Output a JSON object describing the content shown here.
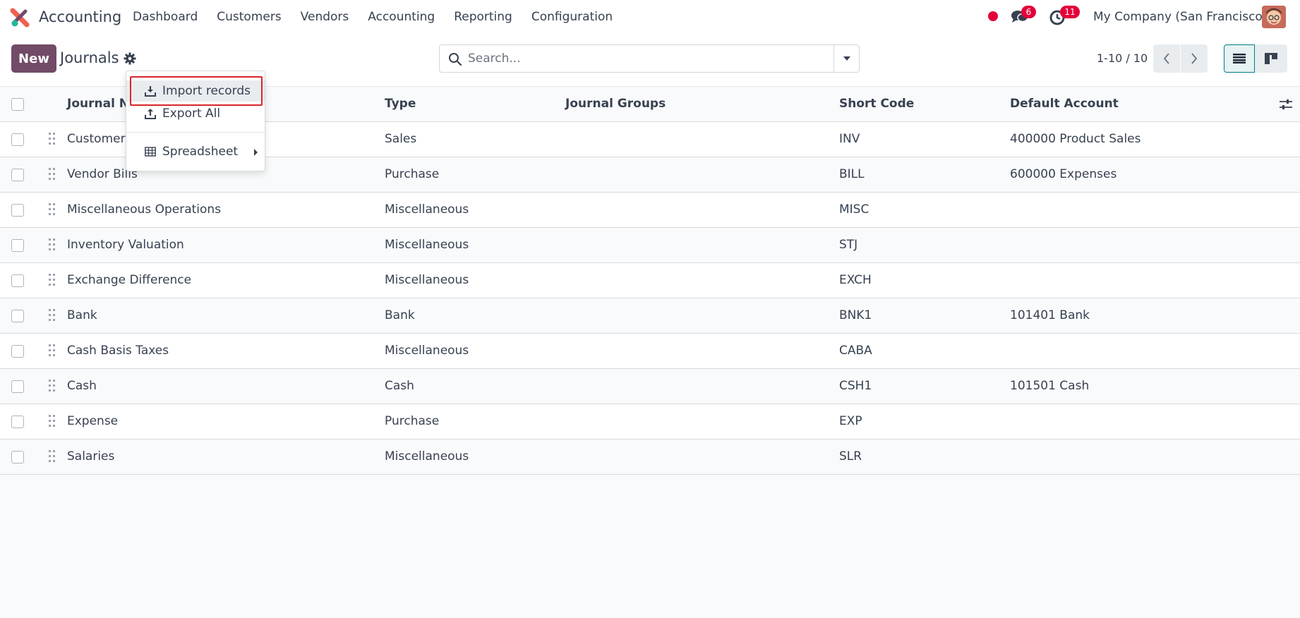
{
  "navbar": {
    "app_name": "Accounting",
    "menu": [
      "Dashboard",
      "Customers",
      "Vendors",
      "Accounting",
      "Reporting",
      "Configuration"
    ],
    "chat_count": "6",
    "activity_count": "11",
    "company": "My Company (San Francisco)",
    "logo_colors": {
      "primary": "#f06050",
      "secondary": "#21b799",
      "dark": "#714b67"
    }
  },
  "control": {
    "new_label": "New",
    "title": "Journals",
    "search_placeholder": "Search...",
    "pager": "1-10 / 10"
  },
  "dropdown": {
    "import_label": "Import records",
    "export_label": "Export All",
    "spreadsheet_label": "Spreadsheet"
  },
  "table": {
    "headers": {
      "journal_name": "Journal Na",
      "type": "Type",
      "journal_groups": "Journal Groups",
      "short_code": "Short Code",
      "default_account": "Default Account"
    },
    "rows": [
      {
        "name": "Customer",
        "type": "Sales",
        "groups": "",
        "code": "INV",
        "account": "400000 Product Sales"
      },
      {
        "name": "Vendor Bills",
        "type": "Purchase",
        "groups": "",
        "code": "BILL",
        "account": "600000 Expenses"
      },
      {
        "name": "Miscellaneous Operations",
        "type": "Miscellaneous",
        "groups": "",
        "code": "MISC",
        "account": ""
      },
      {
        "name": "Inventory Valuation",
        "type": "Miscellaneous",
        "groups": "",
        "code": "STJ",
        "account": ""
      },
      {
        "name": "Exchange Difference",
        "type": "Miscellaneous",
        "groups": "",
        "code": "EXCH",
        "account": ""
      },
      {
        "name": "Bank",
        "type": "Bank",
        "groups": "",
        "code": "BNK1",
        "account": "101401 Bank"
      },
      {
        "name": "Cash Basis Taxes",
        "type": "Miscellaneous",
        "groups": "",
        "code": "CABA",
        "account": ""
      },
      {
        "name": "Cash",
        "type": "Cash",
        "groups": "",
        "code": "CSH1",
        "account": "101501 Cash"
      },
      {
        "name": "Expense",
        "type": "Purchase",
        "groups": "",
        "code": "EXP",
        "account": ""
      },
      {
        "name": "Salaries",
        "type": "Miscellaneous",
        "groups": "",
        "code": "SLR",
        "account": ""
      }
    ]
  },
  "colors": {
    "brand": "#714b67",
    "badge": "#e4003a",
    "active_view": "#017e84",
    "highlight_box": "#d9262a"
  }
}
